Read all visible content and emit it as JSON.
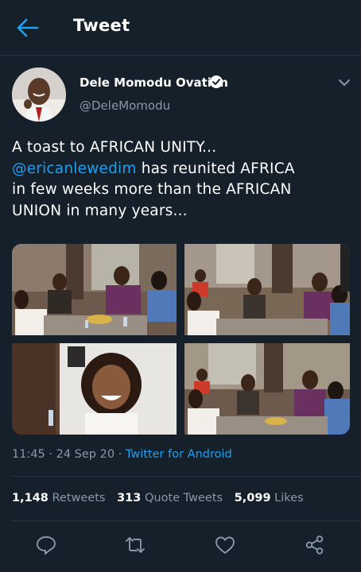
{
  "header": {
    "title": "Tweet",
    "back_icon": "arrow-left-icon"
  },
  "author": {
    "display_name": "Dele Momodu Ovation",
    "handle": "@DeleMomodu",
    "verified": true
  },
  "tweet": {
    "line1": "A toast to AFRICAN UNITY...",
    "mention": "@ericanlewedim",
    "line2_after_mention": " has reunited AFRICA",
    "line3": "in few weeks more than the AFRICAN",
    "line4": "UNION in many years..."
  },
  "media": {
    "count": 4
  },
  "meta": {
    "time": "11:45",
    "separator": " · ",
    "date": "24 Sep 20",
    "source": "Twitter for Android"
  },
  "stats": {
    "retweets_count": "1,148",
    "retweets_label": "Retweets",
    "quotes_count": "313",
    "quotes_label": "Quote Tweets",
    "likes_count": "5,099",
    "likes_label": "Likes"
  },
  "actions": [
    "reply-icon",
    "retweet-icon",
    "like-icon",
    "share-icon"
  ],
  "colors": {
    "background": "#15202b",
    "accent": "#1da1f2",
    "muted": "#8899a6",
    "divider": "#253341"
  }
}
